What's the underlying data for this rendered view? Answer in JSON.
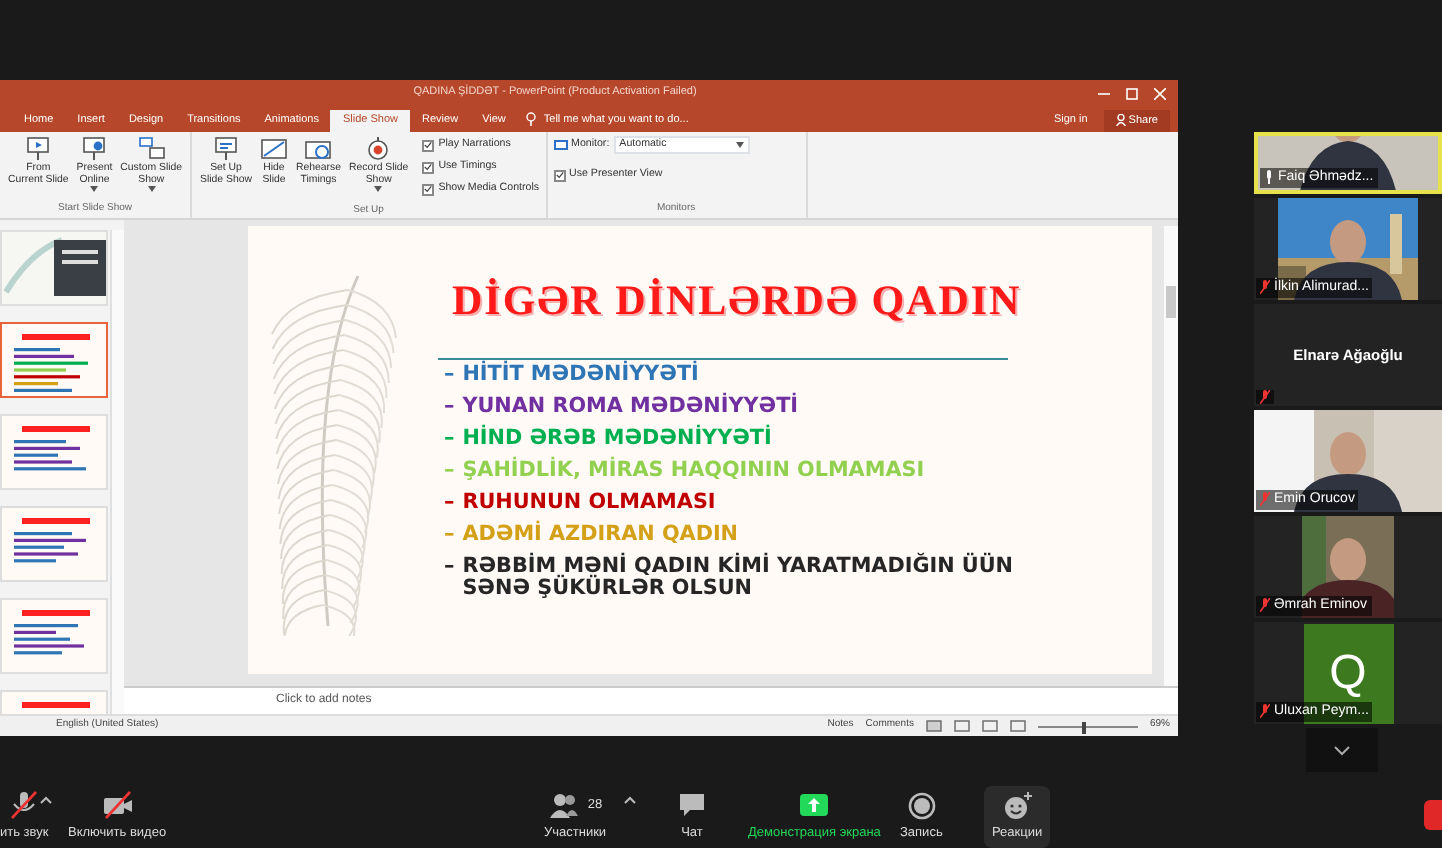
{
  "shared_window": {
    "title": "QADINA ŞİDDƏT - PowerPoint (Product Activation Failed)",
    "tabs": [
      {
        "label": "Home",
        "selected": false
      },
      {
        "label": "Insert",
        "selected": false
      },
      {
        "label": "Design",
        "selected": false
      },
      {
        "label": "Transitions",
        "selected": false
      },
      {
        "label": "Animations",
        "selected": false
      },
      {
        "label": "Slide Show",
        "selected": true
      },
      {
        "label": "Review",
        "selected": false
      },
      {
        "label": "View",
        "selected": false
      }
    ],
    "tell_me": "Tell me what you want to do...",
    "sign_in": "Sign in",
    "share": "Share",
    "ribbon_groups": [
      {
        "label": "Start Slide Show",
        "buttons": [
          {
            "label": "From\nCurrent Slide",
            "dropdown": false
          },
          {
            "label": "Present\nOnline",
            "dropdown": true
          },
          {
            "label": "Custom Slide\nShow",
            "dropdown": true
          }
        ]
      },
      {
        "label": "Set Up",
        "buttons": [
          {
            "label": "Set Up\nSlide Show",
            "dropdown": false
          },
          {
            "label": "Hide\nSlide",
            "dropdown": false
          },
          {
            "label": "Rehearse\nTimings",
            "dropdown": false
          },
          {
            "label": "Record Slide\nShow",
            "dropdown": true
          }
        ],
        "checkboxes": [
          {
            "label": "Play Narrations",
            "checked": true
          },
          {
            "label": "Use Timings",
            "checked": true
          },
          {
            "label": "Show Media Controls",
            "checked": true
          }
        ]
      },
      {
        "label": "Monitors",
        "monitor_label": "Monitor:",
        "monitor_value": "Automatic",
        "checkboxes": [
          {
            "label": "Use Presenter View",
            "checked": true
          }
        ]
      }
    ],
    "thumbnails": [
      {
        "selected": false
      },
      {
        "selected": true
      },
      {
        "selected": false
      },
      {
        "selected": false
      },
      {
        "selected": false
      },
      {
        "selected": false
      }
    ],
    "slide": {
      "title": "DİGƏR DİNLƏRDƏ QADIN",
      "bullets": [
        {
          "marker": "–",
          "text": "HİTİT MƏDƏNİYYƏTİ",
          "color": "#2e75b6"
        },
        {
          "marker": "–",
          "text": "YUNAN ROMA MƏDƏNİYYƏTİ",
          "color": "#7030a0"
        },
        {
          "marker": "–",
          "text": "HİND ƏRƏB MƏDƏNİYYƏTİ",
          "color": "#00b050"
        },
        {
          "marker": "–",
          "text": "ŞAHİDLİK, MİRAS HAQQININ OLMAMASI",
          "color": "#92d050"
        },
        {
          "marker": "–",
          "text": "RUHUNUN OLMAMASI",
          "color": "#c00000"
        },
        {
          "marker": "–",
          "text": "ADƏMİ AZDIRAN QADIN",
          "color": "#d4a017"
        },
        {
          "marker": "–",
          "text": "RƏBBİM MƏNİ QADIN KİMİ YARATMADIĞIN ÜÜN SƏNƏ ŞÜKÜRLƏR OLSUN",
          "color": "#262626"
        }
      ]
    },
    "notes_placeholder": "Click to add notes",
    "status_bar": {
      "language": "English (United States)",
      "notes": "Notes",
      "comments": "Comments",
      "zoom": "69%",
      "zoom_slider": {
        "level": 0.45
      }
    }
  },
  "participants": [
    {
      "name": "Faiq Əhmədz...",
      "kind": "video",
      "muted": false,
      "speaking": true
    },
    {
      "name": "İlkin Alimurad...",
      "kind": "video",
      "muted": true,
      "speaking": false
    },
    {
      "name": "Elnarə Ağaoğlu",
      "kind": "name",
      "muted": true,
      "speaking": false
    },
    {
      "name": "Emin Orucov",
      "kind": "video",
      "muted": true,
      "speaking": false
    },
    {
      "name": "Əmrah Eminov",
      "kind": "video",
      "muted": true,
      "speaking": false
    },
    {
      "name": "Uluxan Peym...",
      "kind": "avatar",
      "avatar": "Q",
      "muted": true,
      "speaking": false
    }
  ],
  "toolbar": [
    {
      "kind": "mic",
      "label": "ить звук",
      "muted": true
    },
    {
      "kind": "video",
      "label": "Включить видео",
      "muted": true
    },
    {
      "kind": "participants",
      "label": "Участники",
      "count": "28"
    },
    {
      "kind": "chat",
      "label": "Чат"
    },
    {
      "kind": "share",
      "label": "Демонстрация экрана"
    },
    {
      "kind": "record",
      "label": "Запись"
    },
    {
      "kind": "reactions",
      "label": "Реакции"
    },
    {
      "kind": "leave"
    }
  ]
}
